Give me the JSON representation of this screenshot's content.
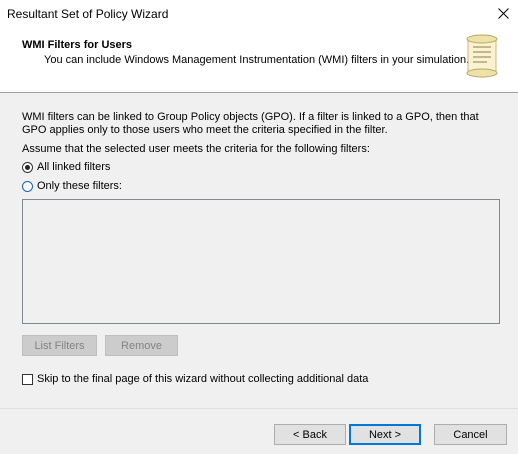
{
  "window": {
    "title": "Resultant Set of Policy Wizard",
    "close_glyph": "✕"
  },
  "header": {
    "title": "WMI Filters for Users",
    "subtitle": "You can include Windows Management Instrumentation (WMI) filters in your simulation.",
    "icon": "scroll-icon"
  },
  "body": {
    "paragraph_line1": "WMI filters can be linked to Group Policy objects (GPO). If a filter is linked to a GPO, then that",
    "paragraph_line2": "GPO applies only to those users who meet the criteria specified in the filter.",
    "assume_label": "Assume that the selected user meets the criteria for the following filters:",
    "radio_all": {
      "label": "All linked filters",
      "checked": true
    },
    "radio_only": {
      "label": "Only these filters:",
      "checked": false
    },
    "filters": []
  },
  "list_buttons": {
    "list_filters": "List Filters",
    "remove": "Remove"
  },
  "skip_checkbox": {
    "label": "Skip to the final page of this wizard without collecting additional data",
    "checked": false
  },
  "footer": {
    "back": "< Back",
    "next": "Next >",
    "cancel": "Cancel"
  },
  "colors": {
    "accent": "#0078d7",
    "background": "#f0f0f0"
  }
}
